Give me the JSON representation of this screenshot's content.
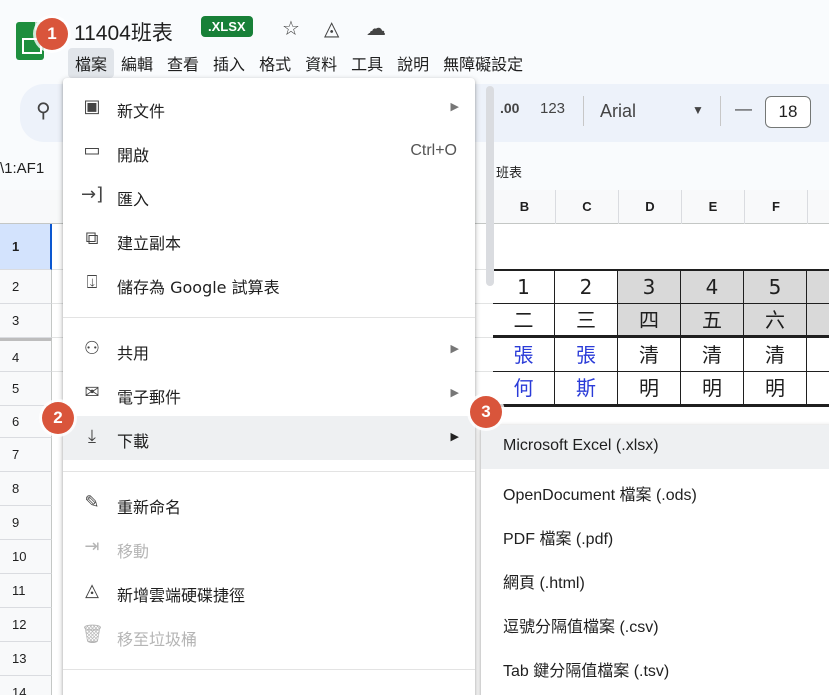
{
  "header": {
    "title": "11404班表",
    "format_badge": ".XLSX"
  },
  "menubar": {
    "items": [
      "檔案",
      "編輯",
      "查看",
      "插入",
      "格式",
      "資料",
      "工具",
      "說明",
      "無障礙設定"
    ]
  },
  "toolbar": {
    "decimal_more": ".00",
    "number_format": "123",
    "font_name": "Arial",
    "font_size": "18",
    "minus": "—"
  },
  "formula_bar": {
    "name_box": "\\1:AF1",
    "content": "班表"
  },
  "grid": {
    "columns": [
      "B",
      "C",
      "D",
      "E",
      "F"
    ],
    "rows": [
      "1",
      "2",
      "3",
      "4",
      "5",
      "6",
      "7",
      "8",
      "9",
      "10",
      "11",
      "12",
      "13",
      "14"
    ],
    "row_cells": [
      [
        "1",
        "2",
        "3",
        "4",
        "5"
      ],
      [
        "二",
        "三",
        "四",
        "五",
        "六"
      ],
      [
        "張",
        "張",
        "清",
        "清",
        "清"
      ],
      [
        "何",
        "斯",
        "明",
        "明",
        "明"
      ]
    ]
  },
  "file_menu": {
    "items": [
      {
        "icon": "new-doc-icon",
        "label": "新文件",
        "arrow": "▶"
      },
      {
        "icon": "folder-icon",
        "label": "開啟",
        "shortcut": "Ctrl+O"
      },
      {
        "icon": "import-icon",
        "label": "匯入"
      },
      {
        "icon": "copy-icon",
        "label": "建立副本"
      },
      {
        "icon": "save-icon",
        "label": "儲存為 Google 試算表"
      },
      {
        "icon": "share-icon",
        "label": "共用",
        "arrow": "▶"
      },
      {
        "icon": "mail-icon",
        "label": "電子郵件",
        "arrow": "▶"
      },
      {
        "icon": "download-icon",
        "label": "下載",
        "arrow": "▶"
      },
      {
        "icon": "pencil-icon",
        "label": "重新命名"
      },
      {
        "icon": "move-icon",
        "label": "移動"
      },
      {
        "icon": "drive-shortcut-icon",
        "label": "新增雲端硬碟捷徑"
      },
      {
        "icon": "trash-icon",
        "label": "移至垃圾桶"
      }
    ]
  },
  "download_submenu": {
    "items": [
      "Microsoft Excel (.xlsx)",
      "OpenDocument 檔案 (.ods)",
      "PDF 檔案 (.pdf)",
      "網頁 (.html)",
      "逗號分隔值檔案 (.csv)",
      "Tab 鍵分隔值檔案 (.tsv)"
    ]
  },
  "step_badges": [
    "1",
    "2",
    "3"
  ],
  "colors": {
    "badge": "#d9553b",
    "xlsx_badge": "#188038",
    "selection": "#0b57d0"
  }
}
